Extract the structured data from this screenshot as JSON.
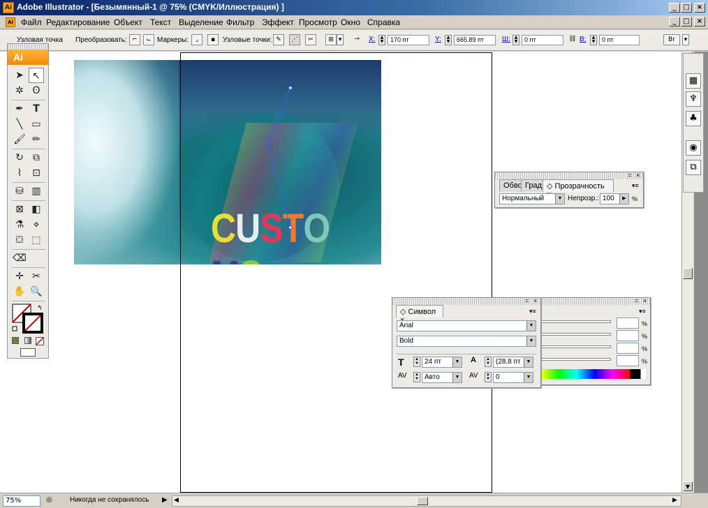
{
  "window": {
    "title": "Adobe Illustrator - [Безымянный-1 @ 75% (CMYK/Иллюстрация) ]",
    "app_icon": "Ai",
    "controls": [
      "_",
      "□",
      "×"
    ]
  },
  "menu": {
    "doc_icon": "Ai",
    "items": [
      "Файл",
      "Редактирование",
      "Объект",
      "Текст",
      "Выделение",
      "Фильтр",
      "Эффект",
      "Просмотр",
      "Окно",
      "Справка"
    ],
    "mdi_controls": [
      "_",
      "□",
      "×"
    ]
  },
  "controlbar": {
    "anchor_label": "Узловая точка",
    "convert_label": "Преобразовать:",
    "handles_label": "Маркеры:",
    "anchors_label": "Узловые точки:",
    "x_label": "X:",
    "x_value": "170 пт",
    "y_label": "Y:",
    "y_value": "665.89 пт",
    "w_label": "Ш:",
    "w_value": "0 пт",
    "h_label": "В:",
    "h_value": "0 пт"
  },
  "tools": {
    "logo": "Ai"
  },
  "artwork": {
    "text": "CUSTOMS",
    "letters": [
      {
        "char": "C",
        "color": "#e8e030"
      },
      {
        "char": "U",
        "color": "#e6eef0"
      },
      {
        "char": "S",
        "color": "#e8355a"
      },
      {
        "char": "T",
        "color": "#f07a2a"
      },
      {
        "char": "O",
        "color": "#7fc7bf"
      },
      {
        "char": "M",
        "color": "#3b3f9c"
      },
      {
        "char": "S",
        "color": "#8ec63f"
      }
    ]
  },
  "transparency_panel": {
    "tabs": [
      "Обво",
      "Град",
      "Прозрачность"
    ],
    "blend_mode": "Нормальный",
    "opacity_label": "Непрозр.:",
    "opacity_value": "100",
    "opacity_unit": "%"
  },
  "character_panel": {
    "tab": "Символ",
    "font_family": "Arial",
    "font_style": "Bold",
    "font_size": "24 пт",
    "leading": "(28.8 пт",
    "kerning": "Авто",
    "tracking": "0"
  },
  "color_panel": {
    "percent_sign": "%"
  },
  "statusbar": {
    "zoom": "75%",
    "status": "Никогда не сохранялось"
  }
}
